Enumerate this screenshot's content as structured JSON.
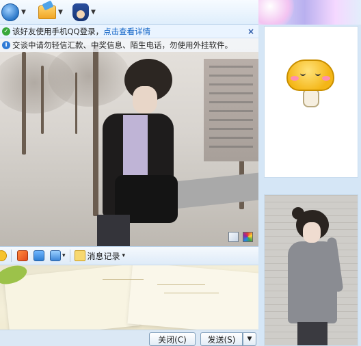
{
  "toolbar": {
    "video_icon": "video-call-icon",
    "file_icon": "send-file-icon",
    "app_icon": "app-agent-icon"
  },
  "notices": {
    "mobile_text": "该好友使用手机QQ登录，",
    "mobile_link": "点击查看详情",
    "warning_text": "交谈中请勿轻信汇款、中奖信息、陌生电话，勿使用外挂软件。",
    "close_symbol": "×"
  },
  "format_bar": {
    "history_label": "消息记录",
    "dropdown_symbol": "▾"
  },
  "buttons": {
    "close_label": "关闭(C)",
    "send_label": "发送(S)",
    "send_menu_symbol": "▼"
  },
  "colors": {
    "accent": "#2f7bd6",
    "link": "#0f62c6",
    "panel": "#d5e6f6"
  }
}
